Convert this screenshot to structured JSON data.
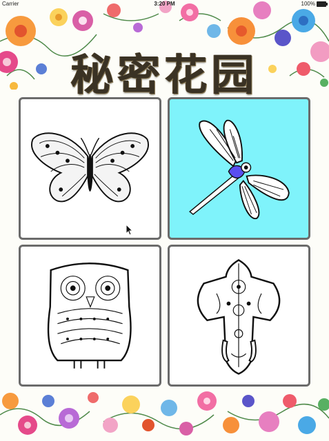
{
  "status_bar": {
    "carrier": "Carrier",
    "time": "3:20 PM",
    "battery": "100%"
  },
  "header": {
    "title": "秘密花园"
  },
  "gallery": {
    "selected_index": 1,
    "selected_color": "#7ff3fb",
    "items": [
      {
        "subject": "butterfly"
      },
      {
        "subject": "dragonfly"
      },
      {
        "subject": "owl"
      },
      {
        "subject": "elephant"
      }
    ]
  }
}
